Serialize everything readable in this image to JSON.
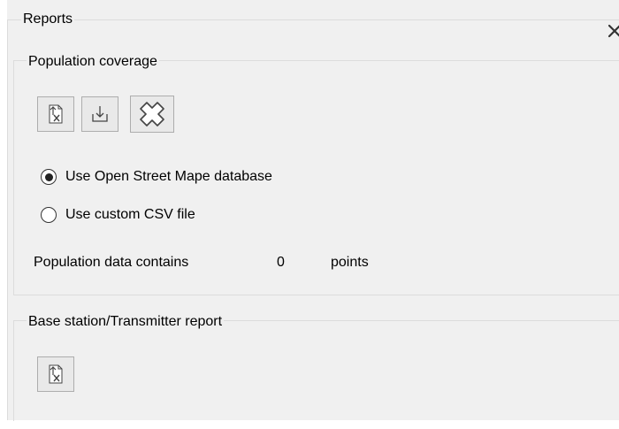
{
  "panel": {
    "title": "Reports"
  },
  "population": {
    "title": "Population coverage",
    "toolbar": [
      {
        "name": "export-report-button",
        "icon": "export-document-icon"
      },
      {
        "name": "download-button",
        "icon": "download-icon"
      },
      {
        "name": "delete-button",
        "icon": "delete-x-icon"
      }
    ],
    "options": [
      {
        "label": "Use Open Street Mape database",
        "selected": true
      },
      {
        "label": "Use custom CSV file",
        "selected": false
      }
    ],
    "status": {
      "prefix": "Population data contains",
      "count": "0",
      "suffix": "points"
    }
  },
  "base_station": {
    "title": "Base station/Transmitter report",
    "toolbar": [
      {
        "name": "export-report-button",
        "icon": "export-document-icon"
      }
    ]
  }
}
